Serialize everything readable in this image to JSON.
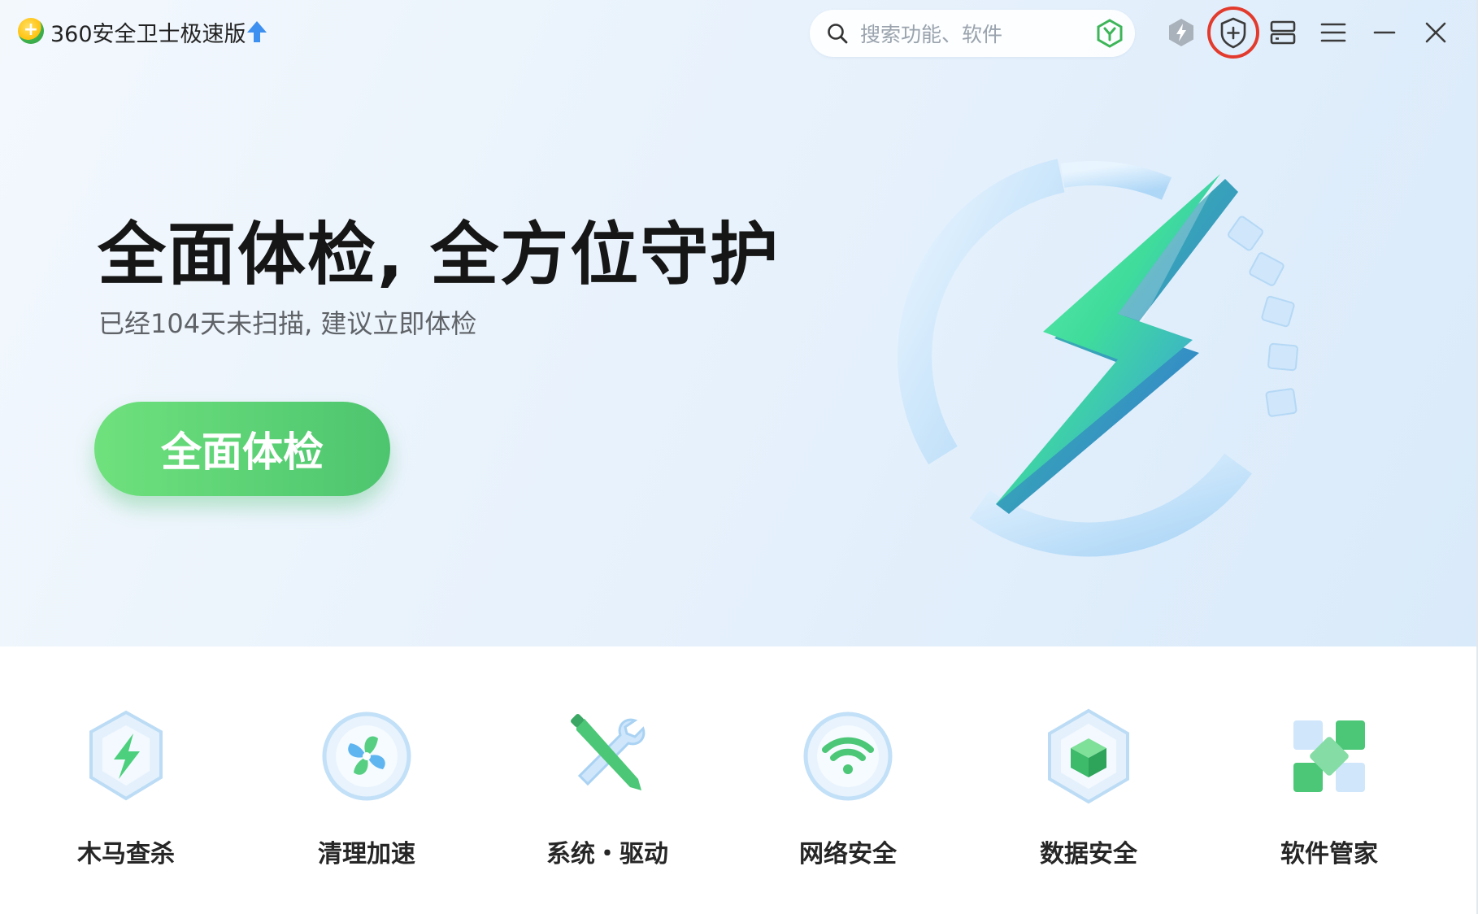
{
  "app": {
    "title": "360安全卫士极速版",
    "upgrade_icon": "upgrade-arrow-icon",
    "logo_icon": "360-logo-icon"
  },
  "search": {
    "placeholder": "搜索功能、软件",
    "value": ""
  },
  "toolbar": {
    "icons": [
      "yuanbao-icon",
      "speed-boost-icon",
      "add-protection-icon",
      "layout-switch-icon",
      "menu-icon",
      "minimize-icon",
      "close-icon"
    ],
    "highlight_color": "#e23b2e"
  },
  "hero": {
    "title": "全面体检, 全方位守护",
    "subtitle": "已经104天未扫描, 建议立即体检",
    "button_label": "全面体检",
    "button_color": "#5bd374",
    "emblem_icon": "lightning-emblem-icon"
  },
  "tools": [
    {
      "label": "木马查杀",
      "icon": "shield-lightning-icon"
    },
    {
      "label": "清理加速",
      "icon": "fan-icon"
    },
    {
      "label": "系统・驱动",
      "icon": "tools-icon"
    },
    {
      "label": "网络安全",
      "icon": "wifi-icon"
    },
    {
      "label": "数据安全",
      "icon": "data-cube-icon"
    },
    {
      "label": "软件管家",
      "icon": "software-grid-icon"
    }
  ]
}
